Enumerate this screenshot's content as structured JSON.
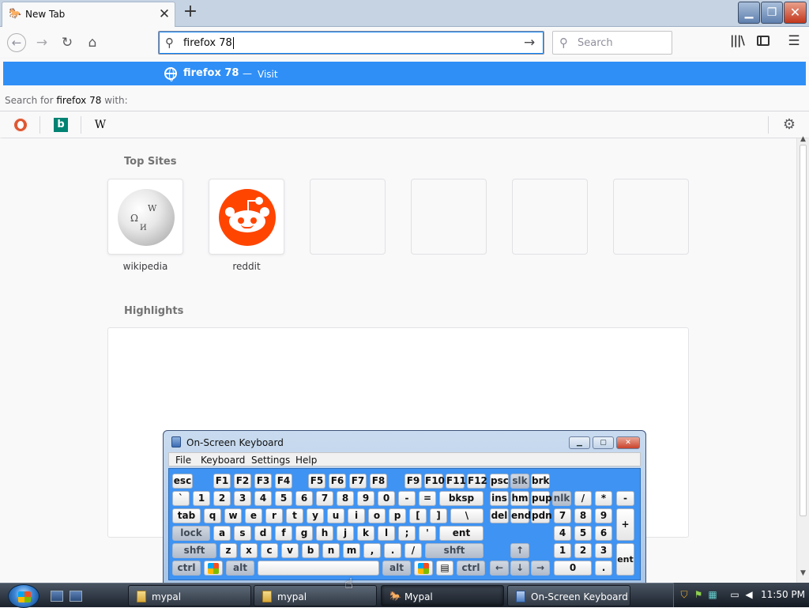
{
  "browser": {
    "tab": {
      "title": "New Tab",
      "close_icon": "close-icon"
    },
    "new_tab_icon": "plus-icon",
    "window_controls": [
      "minimize",
      "maximize",
      "close"
    ],
    "urlbar": {
      "value": "firefox 78",
      "search_icon": "search-icon",
      "go_icon": "arrow-right-icon"
    },
    "searchbar": {
      "placeholder": "Search"
    },
    "accent": "#0a84ff"
  },
  "dropdown": {
    "suggestion": {
      "text": "firefox 78",
      "separator": "—",
      "action": "Visit",
      "highlight_color": "#2f8ff6"
    },
    "search_with_prefix": "Search for",
    "search_with_term": "firefox 78",
    "search_with_suffix": "with:",
    "engines": [
      {
        "name": "DuckDuckGo",
        "icon": "duckduckgo-icon"
      },
      {
        "name": "Bing",
        "icon": "bing-icon",
        "glyph": "b"
      },
      {
        "name": "Wikipedia",
        "icon": "wikipedia-icon",
        "glyph": "W"
      }
    ]
  },
  "newtab": {
    "top_sites_title": "Top Sites",
    "top_sites": [
      {
        "label": "wikipedia"
      },
      {
        "label": "reddit"
      },
      {
        "label": ""
      },
      {
        "label": ""
      },
      {
        "label": ""
      },
      {
        "label": ""
      }
    ],
    "highlights_title": "Highlights"
  },
  "osk": {
    "title": "On-Screen Keyboard",
    "menu": [
      "File",
      "Keyboard",
      "Settings",
      "Help"
    ],
    "rows": [
      [
        "esc",
        "F1",
        "F2",
        "F3",
        "F4",
        "F5",
        "F6",
        "F7",
        "F8",
        "F9",
        "F10",
        "F11",
        "F12",
        "psc",
        "slk",
        "brk"
      ],
      [
        "`",
        "1",
        "2",
        "3",
        "4",
        "5",
        "6",
        "7",
        "8",
        "9",
        "0",
        "-",
        "=",
        "bksp",
        "ins",
        "hm",
        "pup",
        "nlk",
        "/",
        "*",
        "-"
      ],
      [
        "tab",
        "q",
        "w",
        "e",
        "r",
        "t",
        "y",
        "u",
        "i",
        "o",
        "p",
        "[",
        "]",
        "\\",
        "del",
        "end",
        "pdn",
        "7",
        "8",
        "9",
        "+"
      ],
      [
        "lock",
        "a",
        "s",
        "d",
        "f",
        "g",
        "h",
        "j",
        "k",
        "l",
        ";",
        "'",
        "ent",
        "4",
        "5",
        "6"
      ],
      [
        "shft",
        "z",
        "x",
        "c",
        "v",
        "b",
        "n",
        "m",
        ",",
        ".",
        "/",
        "shft",
        "↑",
        "1",
        "2",
        "3",
        "ent"
      ],
      [
        "ctrl",
        "alt",
        "alt",
        "ctrl",
        "←",
        "↓",
        "→",
        "0",
        "."
      ]
    ]
  },
  "taskbar": {
    "tasks": [
      {
        "label": "mypal",
        "icon": "folder-icon"
      },
      {
        "label": "mypal",
        "icon": "folder-icon"
      },
      {
        "label": "Mypal",
        "icon": "mypal-icon"
      },
      {
        "label": "On-Screen Keyboard",
        "icon": "keyboard-icon"
      }
    ],
    "clock": "11:50 PM"
  }
}
